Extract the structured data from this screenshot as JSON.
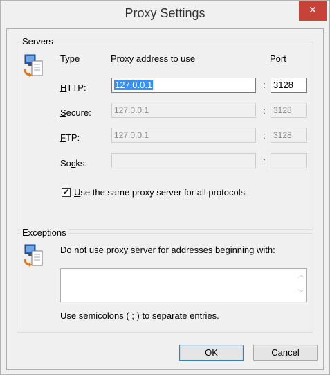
{
  "window": {
    "title": "Proxy Settings",
    "close_glyph": "✕"
  },
  "servers": {
    "group_label": "Servers",
    "icon": "network-computer-icon",
    "header_type": "Type",
    "header_address": "Proxy address to use",
    "header_port": "Port",
    "rows": [
      {
        "label_pre": "",
        "label_u": "H",
        "label_post": "TTP:",
        "address": "127.0.0.1",
        "port": "3128",
        "enabled": true
      },
      {
        "label_pre": "",
        "label_u": "S",
        "label_post": "ecure:",
        "address": "127.0.0.1",
        "port": "3128",
        "enabled": false
      },
      {
        "label_pre": "",
        "label_u": "F",
        "label_post": "TP:",
        "address": "127.0.0.1",
        "port": "3128",
        "enabled": false
      },
      {
        "label_pre": "So",
        "label_u": "c",
        "label_post": "ks:",
        "address": "",
        "port": "",
        "enabled": false
      }
    ],
    "colon": ":",
    "same_proxy": {
      "checked": true,
      "check_glyph": "✔",
      "label_u": "U",
      "label_post": "se the same proxy server for all protocols"
    }
  },
  "exceptions": {
    "group_label": "Exceptions",
    "icon": "network-computer-icon",
    "instruction_pre": "Do ",
    "instruction_u": "n",
    "instruction_post": "ot use proxy server for addresses beginning with:",
    "value": "",
    "hint": "Use semicolons ( ; ) to separate entries."
  },
  "buttons": {
    "ok": "OK",
    "cancel": "Cancel"
  }
}
